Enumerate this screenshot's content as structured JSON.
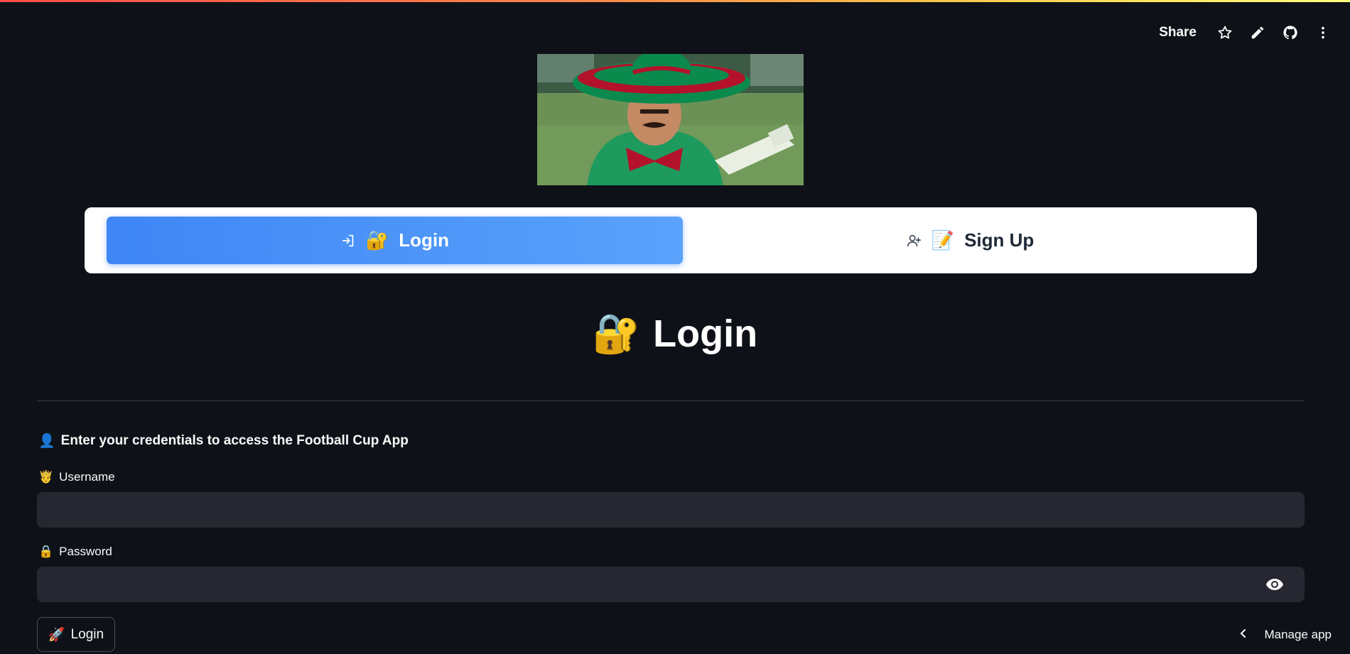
{
  "toolbar": {
    "share_label": "Share",
    "icons": [
      "star-icon",
      "pencil-icon",
      "github-icon",
      "more-vertical-icon"
    ]
  },
  "hero": {
    "icon": "mariachi-image"
  },
  "tabs": [
    {
      "label": "Login",
      "emoji": "🔐",
      "icon": "login-icon",
      "active": true
    },
    {
      "label": "Sign Up",
      "emoji": "📝",
      "icon": "user-plus-icon",
      "active": false
    }
  ],
  "page": {
    "title": "Login",
    "title_emoji": "🔐",
    "subheading": "Enter your credentials to access the Football Cup App",
    "subheading_emoji": "👤"
  },
  "form": {
    "username_label": "Username",
    "username_emoji": "🤴",
    "username_value": "",
    "password_label": "Password",
    "password_emoji": "🔒",
    "password_value": "",
    "submit_label": "Login",
    "submit_emoji": "🚀"
  },
  "footer": {
    "manage_label": "Manage app"
  },
  "colors": {
    "background": "#0e1117",
    "accent": "#3f86f6",
    "input_bg": "#262730"
  }
}
